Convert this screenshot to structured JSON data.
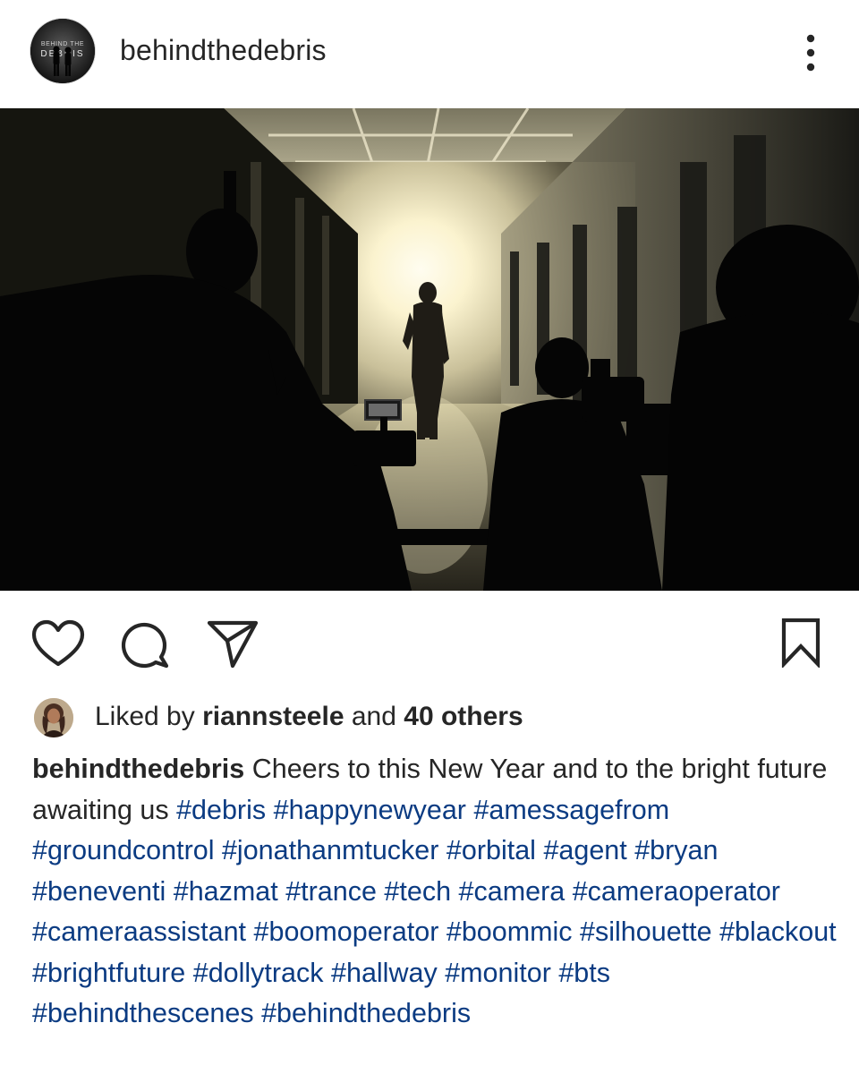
{
  "post": {
    "username": "behindthedebris",
    "avatar_lettering": "BEHIND THE DEBRIS",
    "photo_description_icon": "film-set-hallway-photo",
    "actions": {
      "like_icon": "heart-icon",
      "comment_icon": "comment-icon",
      "share_icon": "paper-plane-icon",
      "save_icon": "bookmark-icon",
      "more_icon": "more-vertical-icon"
    },
    "likes": {
      "prefix": "Liked by",
      "liker": "riannsteele",
      "connector": "and",
      "others": "40 others"
    },
    "caption": {
      "user": "behindthedebris",
      "text": "Cheers to this New Year and to the bright future awaiting us",
      "hashtags": [
        "#debris",
        "#happynewyear",
        "#amessagefrom",
        "#groundcontrol",
        "#jonathanmtucker",
        "#orbital",
        "#agent",
        "#bryan",
        "#beneventi",
        "#hazmat",
        "#trance",
        "#tech",
        "#camera",
        "#cameraoperator",
        "#cameraassistant",
        "#boomoperator",
        "#boommic",
        "#silhouette",
        "#blackout",
        "#brightfuture",
        "#dollytrack",
        "#hallway",
        "#monitor",
        "#bts",
        "#behindthescenes",
        "#behindthedebris"
      ]
    },
    "colors": {
      "text": "#262626",
      "hashtag": "#0b3b82",
      "background": "#ffffff"
    }
  }
}
